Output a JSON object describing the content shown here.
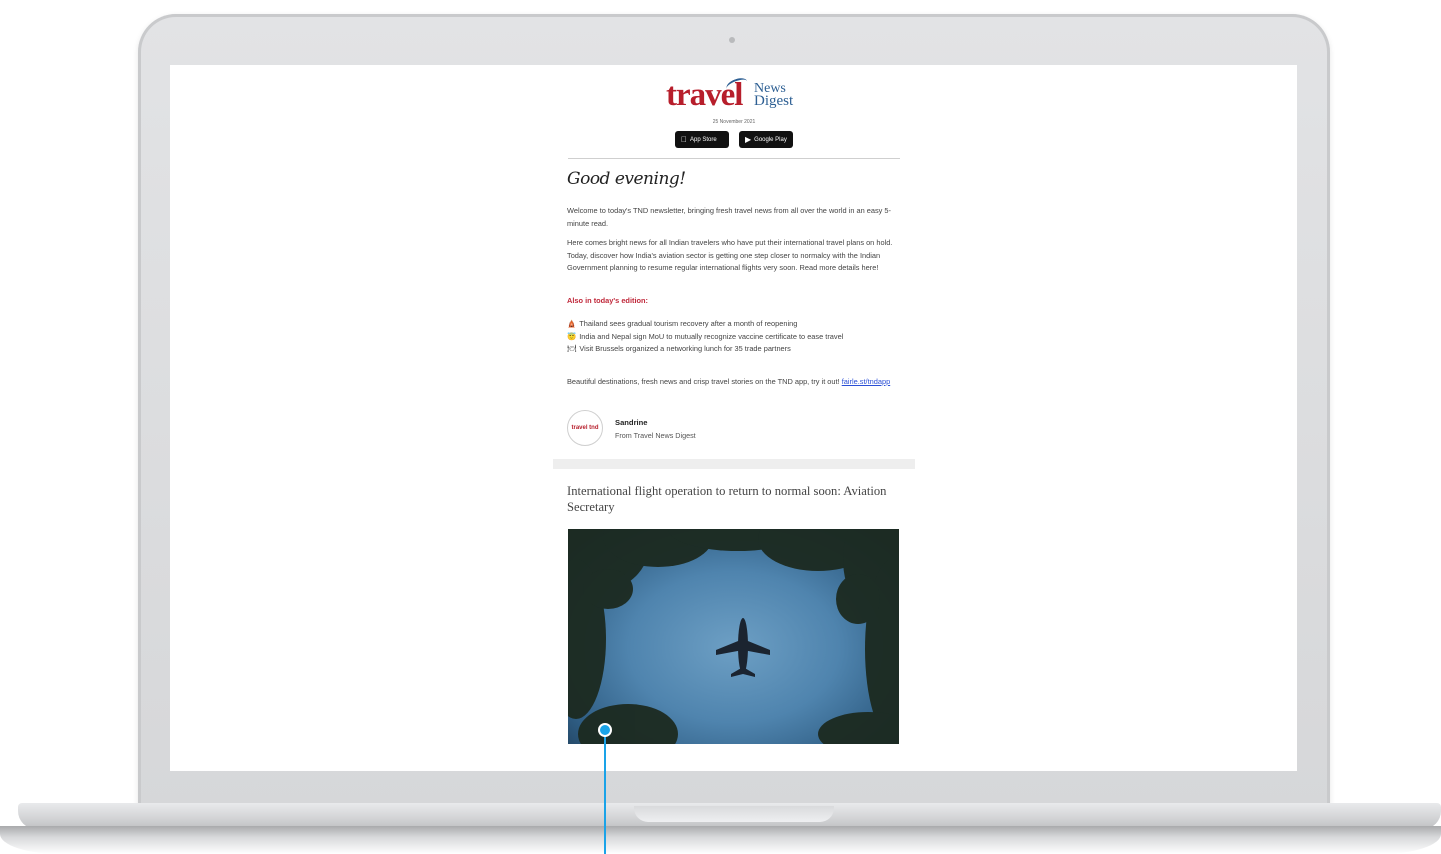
{
  "logo": {
    "word": "travel",
    "news": "News",
    "digest": "Digest"
  },
  "date": "25 November 2021",
  "app_store": {
    "label": "App Store",
    "icon": "apple-icon"
  },
  "google_play": {
    "label": "Google Play",
    "icon": "play-icon"
  },
  "greeting": "Good evening!",
  "intro": "Welcome to today's TND newsletter, bringing fresh travel news from all over the world in an easy 5-minute read.",
  "lead": "Here comes bright news for all Indian travelers who have put their international travel plans on hold. Today, discover how India's aviation sector is getting one step closer to normalcy with the Indian Government planning to resume regular international flights very soon. Read more details here!",
  "also_heading": "Also in today's edition:",
  "bullets": [
    {
      "emoji": "🛕",
      "text": "Thailand sees gradual tourism recovery after a month of reopening"
    },
    {
      "emoji": "😇",
      "text": "India and Nepal sign MoU to mutually recognize vaccine certificate to ease travel"
    },
    {
      "emoji": "🍽",
      "text": "Visit Brussels organized a networking lunch for 35 trade partners"
    }
  ],
  "app_promo": "Beautiful destinations, fresh news and crisp travel stories on the TND app, try it out!",
  "app_link": "fairle.st/tndapp",
  "signature": {
    "avatar_text": "travel tnd",
    "name": "Sandrine",
    "from": "From Travel News Digest"
  },
  "article": {
    "title": "International flight operation to return to normal soon: Aviation Secretary"
  },
  "colors": {
    "brand_red": "#b71e2b",
    "brand_blue": "#2d5f93",
    "callout": "#1aa3e8"
  }
}
